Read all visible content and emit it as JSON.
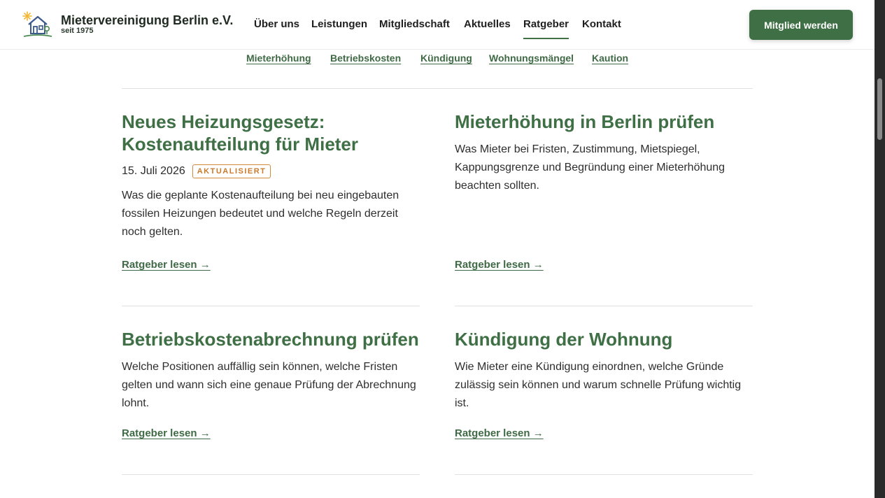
{
  "brand": {
    "name": "Mietervereinigung Berlin e.V.",
    "tagline": "seit 1975"
  },
  "nav": [
    {
      "label": "Über uns",
      "active": false
    },
    {
      "label": "Leistungen",
      "active": false
    },
    {
      "label": "Mitgliedschaft",
      "active": false
    },
    {
      "label": "Aktuelles",
      "active": false
    },
    {
      "label": "Ratgeber",
      "active": true
    }
  ],
  "nav_contact": "Kontakt",
  "cta_label": "Mitglied werden",
  "topics": [
    "Mieterhöhung",
    "Betriebskosten",
    "Kündigung",
    "Wohnungsmängel",
    "Kaution"
  ],
  "articles": [
    {
      "title_line1": "Neues Heizungsgesetz:",
      "title_line2": "Kostenaufteilung für Mieter",
      "date": "15. Juli 2026",
      "badge": "AKTUALISIERT",
      "description": "Was die geplante Kostenaufteilung bei neu eingebauten fossilen Heizungen bedeutet und welche Regeln derzeit noch gelten.",
      "link": "Ratgeber lesen →"
    },
    {
      "title": "Mieterhöhung in Berlin prüfen",
      "description": "Was Mieter bei Fristen, Zustimmung, Mietspiegel, Kappungsgrenze und Begründung einer Mieterhöhung beachten sollten.",
      "link": "Ratgeber lesen →"
    },
    {
      "title": "Betriebskostenabrechnung prüfen",
      "description": "Welche Positionen auffällig sein können, welche Fristen gelten und wann sich eine genaue Prüfung der Abrechnung lohnt.",
      "link": "Ratgeber lesen →"
    },
    {
      "title": "Kündigung der Wohnung",
      "description": "Wie Mieter eine Kündigung einordnen, welche Gründe zulässig sein können und warum schnelle Prüfung wichtig ist.",
      "link": "Ratgeber lesen →"
    }
  ],
  "colors": {
    "brand_green": "#3f6f45",
    "badge_orange": "#c97a2b",
    "logo_sun": "#f2b632",
    "logo_house": "#3c5a8c"
  },
  "icons": {
    "logo": "house-sun-icon"
  }
}
